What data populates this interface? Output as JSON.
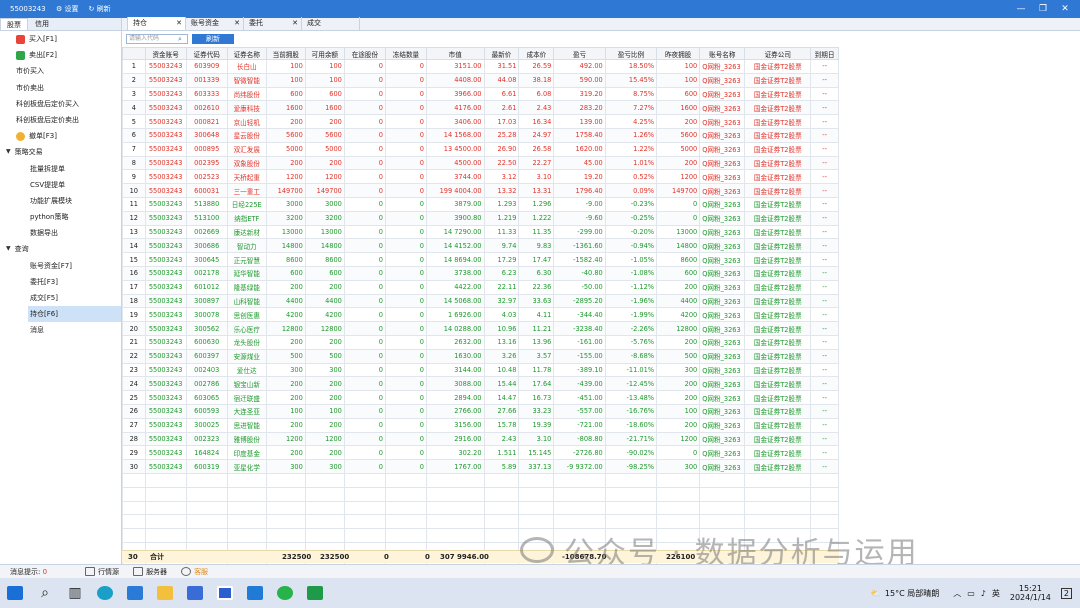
{
  "window": {
    "title": "55003243",
    "settings_label": "设置",
    "refresh_label": "刷新"
  },
  "sidebar": {
    "tabs": [
      "股票",
      "信用"
    ],
    "items": [
      {
        "label": "买入[F1]",
        "icon": "buy-icon",
        "kind": "item"
      },
      {
        "label": "卖出[F2]",
        "icon": "sell-icon",
        "kind": "item"
      },
      {
        "label": "市价买入",
        "kind": "item"
      },
      {
        "label": "市价卖出",
        "kind": "item"
      },
      {
        "label": "科创板盘后定价买入",
        "kind": "item"
      },
      {
        "label": "科创板盘后定价卖出",
        "kind": "item"
      },
      {
        "label": "撤单[F3]",
        "icon": "undo-icon",
        "kind": "item"
      },
      {
        "label": "策略交易",
        "kind": "group"
      },
      {
        "label": "批量拆提单",
        "kind": "sub"
      },
      {
        "label": "CSV提提单",
        "kind": "sub"
      },
      {
        "label": "功能扩展模块",
        "kind": "sub"
      },
      {
        "label": "python策略",
        "kind": "sub"
      },
      {
        "label": "数据导出",
        "kind": "sub"
      },
      {
        "label": "查询",
        "kind": "group"
      },
      {
        "label": "账号资金[F7]",
        "kind": "sub"
      },
      {
        "label": "委托[F3]",
        "kind": "sub"
      },
      {
        "label": "成交[F5]",
        "kind": "sub"
      },
      {
        "label": "持仓[F6]",
        "kind": "sub",
        "selected": true
      },
      {
        "label": "消息",
        "kind": "sub"
      }
    ]
  },
  "tabs": [
    {
      "label": "持仓",
      "active": true
    },
    {
      "label": "账号资金"
    },
    {
      "label": "委托"
    },
    {
      "label": "成交"
    }
  ],
  "toolbar": {
    "search_placeholder": "请输入代码",
    "refresh_button": "刷新"
  },
  "table": {
    "columns": [
      "",
      "资金账号",
      "证券代码",
      "证券名称",
      "当前拥股",
      "可用余额",
      "在途股份",
      "冻结数量",
      "市值",
      "最新价",
      "成本价",
      "盈亏",
      "盈亏比例",
      "昨夜拥股",
      "账号名称",
      "证券公司",
      "到期日"
    ],
    "rows": [
      [
        "1",
        "55003243",
        "603909",
        "长白山",
        "100",
        "100",
        "0",
        "0",
        "3151.00",
        "31.51",
        "26.59",
        "492.00",
        "18.50%",
        "100",
        "Q网粉_3263",
        "国金证券T2股票",
        "--"
      ],
      [
        "2",
        "55003243",
        "001339",
        "智微智能",
        "100",
        "100",
        "0",
        "0",
        "4408.00",
        "44.08",
        "38.18",
        "590.00",
        "15.45%",
        "100",
        "Q网粉_3263",
        "国金证券T2股票",
        "--"
      ],
      [
        "3",
        "55003243",
        "603333",
        "尚纬股份",
        "600",
        "600",
        "0",
        "0",
        "3966.00",
        "6.61",
        "6.08",
        "319.20",
        "8.75%",
        "600",
        "Q网粉_3263",
        "国金证券T2股票",
        "--"
      ],
      [
        "4",
        "55003243",
        "002610",
        "爱康科技",
        "1600",
        "1600",
        "0",
        "0",
        "4176.00",
        "2.61",
        "2.43",
        "283.20",
        "7.27%",
        "1600",
        "Q网粉_3263",
        "国金证券T2股票",
        "--"
      ],
      [
        "5",
        "55003243",
        "000821",
        "京山轻机",
        "200",
        "200",
        "0",
        "0",
        "3406.00",
        "17.03",
        "16.34",
        "139.00",
        "4.25%",
        "200",
        "Q网粉_3263",
        "国金证券T2股票",
        "--"
      ],
      [
        "6",
        "55003243",
        "300648",
        "星云股份",
        "5600",
        "5600",
        "0",
        "0",
        "14 1568.00",
        "25.28",
        "24.97",
        "1758.40",
        "1.26%",
        "5600",
        "Q网粉_3263",
        "国金证券T2股票",
        "--"
      ],
      [
        "7",
        "55003243",
        "000895",
        "双汇发展",
        "5000",
        "5000",
        "0",
        "0",
        "13 4500.00",
        "26.90",
        "26.58",
        "1620.00",
        "1.22%",
        "5000",
        "Q网粉_3263",
        "国金证券T2股票",
        "--"
      ],
      [
        "8",
        "55003243",
        "002395",
        "双象股份",
        "200",
        "200",
        "0",
        "0",
        "4500.00",
        "22.50",
        "22.27",
        "45.00",
        "1.01%",
        "200",
        "Q网粉_3263",
        "国金证券T2股票",
        "--"
      ],
      [
        "9",
        "55003243",
        "002523",
        "天桥起重",
        "1200",
        "1200",
        "0",
        "0",
        "3744.00",
        "3.12",
        "3.10",
        "19.20",
        "0.52%",
        "1200",
        "Q网粉_3263",
        "国金证券T2股票",
        "--"
      ],
      [
        "10",
        "55003243",
        "600031",
        "三一重工",
        "149700",
        "149700",
        "0",
        "0",
        "199 4004.00",
        "13.32",
        "13.31",
        "1796.40",
        "0.09%",
        "149700",
        "Q网粉_3263",
        "国金证券T2股票",
        "--"
      ],
      [
        "11",
        "55003243",
        "513880",
        "日经225E",
        "3000",
        "3000",
        "0",
        "0",
        "3879.00",
        "1.293",
        "1.296",
        "-9.00",
        "-0.23%",
        "0",
        "Q网粉_3263",
        "国金证券T2股票",
        "--"
      ],
      [
        "12",
        "55003243",
        "513100",
        "纳指ETF",
        "3200",
        "3200",
        "0",
        "0",
        "3900.80",
        "1.219",
        "1.222",
        "-9.60",
        "-0.25%",
        "0",
        "Q网粉_3263",
        "国金证券T2股票",
        "--"
      ],
      [
        "13",
        "55003243",
        "002669",
        "康达新材",
        "13000",
        "13000",
        "0",
        "0",
        "14 7290.00",
        "11.33",
        "11.35",
        "-299.00",
        "-0.20%",
        "13000",
        "Q网粉_3263",
        "国金证券T2股票",
        "--"
      ],
      [
        "14",
        "55003243",
        "300686",
        "智动力",
        "14800",
        "14800",
        "0",
        "0",
        "14 4152.00",
        "9.74",
        "9.83",
        "-1361.60",
        "-0.94%",
        "14800",
        "Q网粉_3263",
        "国金证券T2股票",
        "--"
      ],
      [
        "15",
        "55003243",
        "300645",
        "正元智慧",
        "8600",
        "8600",
        "0",
        "0",
        "14 8694.00",
        "17.29",
        "17.47",
        "-1582.40",
        "-1.05%",
        "8600",
        "Q网粉_3263",
        "国金证券T2股票",
        "--"
      ],
      [
        "16",
        "55003243",
        "002178",
        "延华智能",
        "600",
        "600",
        "0",
        "0",
        "3738.00",
        "6.23",
        "6.30",
        "-40.80",
        "-1.08%",
        "600",
        "Q网粉_3263",
        "国金证券T2股票",
        "--"
      ],
      [
        "17",
        "55003243",
        "601012",
        "隆基绿能",
        "200",
        "200",
        "0",
        "0",
        "4422.00",
        "22.11",
        "22.36",
        "-50.00",
        "-1.12%",
        "200",
        "Q网粉_3263",
        "国金证券T2股票",
        "--"
      ],
      [
        "18",
        "55003243",
        "300897",
        "山科智能",
        "4400",
        "4400",
        "0",
        "0",
        "14 5068.00",
        "32.97",
        "33.63",
        "-2895.20",
        "-1.96%",
        "4400",
        "Q网粉_3263",
        "国金证券T2股票",
        "--"
      ],
      [
        "19",
        "55003243",
        "300078",
        "思创医惠",
        "4200",
        "4200",
        "0",
        "0",
        "1 6926.00",
        "4.03",
        "4.11",
        "-344.40",
        "-1.99%",
        "4200",
        "Q网粉_3263",
        "国金证券T2股票",
        "--"
      ],
      [
        "20",
        "55003243",
        "300562",
        "乐心医疗",
        "12800",
        "12800",
        "0",
        "0",
        "14 0288.00",
        "10.96",
        "11.21",
        "-3238.40",
        "-2.26%",
        "12800",
        "Q网粉_3263",
        "国金证券T2股票",
        "--"
      ],
      [
        "21",
        "55003243",
        "600630",
        "龙头股份",
        "200",
        "200",
        "0",
        "0",
        "2632.00",
        "13.16",
        "13.96",
        "-161.00",
        "-5.76%",
        "200",
        "Q网粉_3263",
        "国金证券T2股票",
        "--"
      ],
      [
        "22",
        "55003243",
        "600397",
        "安源煤业",
        "500",
        "500",
        "0",
        "0",
        "1630.00",
        "3.26",
        "3.57",
        "-155.00",
        "-8.68%",
        "500",
        "Q网粉_3263",
        "国金证券T2股票",
        "--"
      ],
      [
        "23",
        "55003243",
        "002403",
        "爱仕达",
        "300",
        "300",
        "0",
        "0",
        "3144.00",
        "10.48",
        "11.78",
        "-389.10",
        "-11.01%",
        "300",
        "Q网粉_3263",
        "国金证券T2股票",
        "--"
      ],
      [
        "24",
        "55003243",
        "002786",
        "银宝山新",
        "200",
        "200",
        "0",
        "0",
        "3088.00",
        "15.44",
        "17.64",
        "-439.00",
        "-12.45%",
        "200",
        "Q网粉_3263",
        "国金证券T2股票",
        "--"
      ],
      [
        "25",
        "55003243",
        "603065",
        "宿迁联盛",
        "200",
        "200",
        "0",
        "0",
        "2894.00",
        "14.47",
        "16.73",
        "-451.00",
        "-13.48%",
        "200",
        "Q网粉_3263",
        "国金证券T2股票",
        "--"
      ],
      [
        "26",
        "55003243",
        "600593",
        "大连圣亚",
        "100",
        "100",
        "0",
        "0",
        "2766.00",
        "27.66",
        "33.23",
        "-557.00",
        "-16.76%",
        "100",
        "Q网粉_3263",
        "国金证券T2股票",
        "--"
      ],
      [
        "27",
        "55003243",
        "300025",
        "思进智能",
        "200",
        "200",
        "0",
        "0",
        "3156.00",
        "15.78",
        "19.39",
        "-721.00",
        "-18.60%",
        "200",
        "Q网粉_3263",
        "国金证券T2股票",
        "--"
      ],
      [
        "28",
        "55003243",
        "002323",
        "雅博股份",
        "1200",
        "1200",
        "0",
        "0",
        "2916.00",
        "2.43",
        "3.10",
        "-808.80",
        "-21.71%",
        "1200",
        "Q网粉_3263",
        "国金证券T2股票",
        "--"
      ],
      [
        "29",
        "55003243",
        "164824",
        "印度基金",
        "200",
        "200",
        "0",
        "0",
        "302.20",
        "1.511",
        "15.145",
        "-2726.80",
        "-90.02%",
        "0",
        "Q网粉_3263",
        "国金证券T2股票",
        "--"
      ],
      [
        "30",
        "55003243",
        "600319",
        "亚星化学",
        "300",
        "300",
        "0",
        "0",
        "1767.00",
        "5.89",
        "337.13",
        "-9 9372.00",
        "-98.25%",
        "300",
        "Q网粉_3263",
        "国金证券T2股票",
        "--"
      ]
    ],
    "summary": {
      "count": "30",
      "label": "合计",
      "current": "232500",
      "available": "232500",
      "transit": "0",
      "frozen": "0",
      "market_value": "307 9946.00",
      "pnl": "-108678.70",
      "yesterday": "226100"
    }
  },
  "statusbar": {
    "msg_label": "消息提示:",
    "msg_count": "0",
    "quote_label": "行情源",
    "server_label": "服务器",
    "service_label": "客服"
  },
  "watermark": "公众号 · 数据分析与运用",
  "taskbar": {
    "weather": "15°C 局部晴朗",
    "ime": "英",
    "time": "15:21",
    "date": "2024/1/14",
    "notif": "2"
  },
  "colors": {
    "accent": "#2f78d3",
    "profit": "#e0342a",
    "loss": "#1e9a2c"
  }
}
